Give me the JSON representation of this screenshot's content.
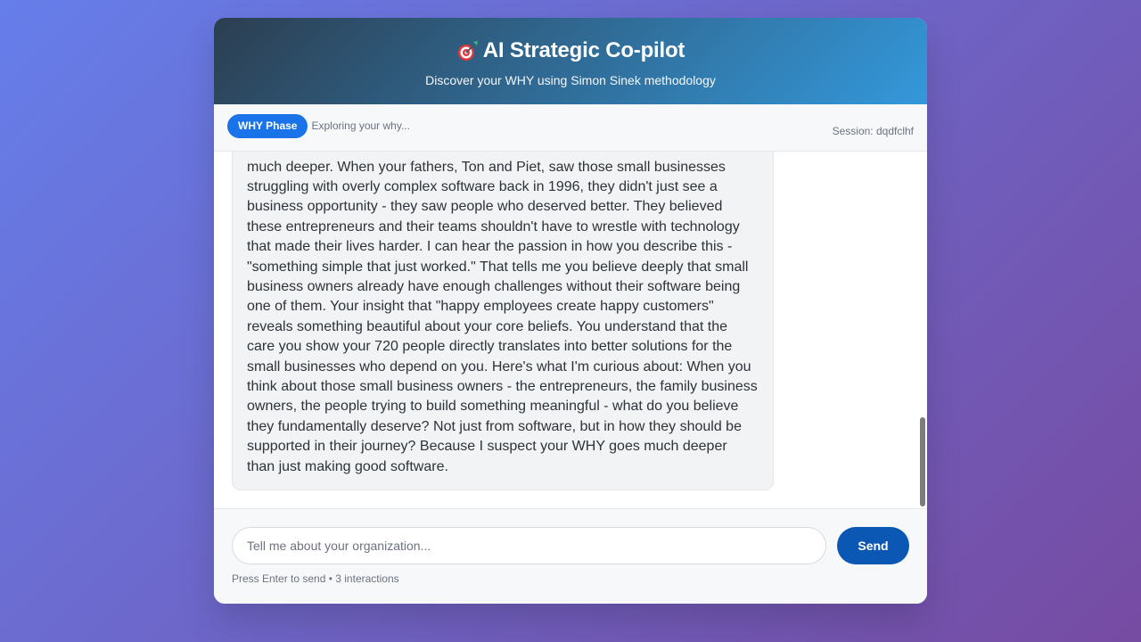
{
  "header": {
    "title": "AI Strategic Co-pilot",
    "subtitle": "Discover your WHY using Simon Sinek methodology",
    "icon": "dart-target-icon"
  },
  "phase": {
    "badge": "WHY Phase",
    "description": "Exploring your why...",
    "session": "Session: dqdfclhf"
  },
  "messages": [
    {
      "role": "assistant",
      "text": "much deeper. When your fathers, Ton and Piet, saw those small businesses struggling with overly complex software back in 1996, they didn't just see a business opportunity - they saw people who deserved better. They believed these entrepreneurs and their teams shouldn't have to wrestle with technology that made their lives harder. I can hear the passion in how you describe this - \"something simple that just worked.\" That tells me you believe deeply that small business owners already have enough challenges without their software being one of them. Your insight that \"happy employees create happy customers\" reveals something beautiful about your core beliefs. You understand that the care you show your 720 people directly translates into better solutions for the small businesses who depend on you. Here's what I'm curious about: When you think about those small business owners - the entrepreneurs, the family business owners, the people trying to build something meaningful - what do you believe they fundamentally deserve? Not just from software, but in how they should be supported in their journey? Because I suspect your WHY goes much deeper than just making good software."
    }
  ],
  "input": {
    "placeholder": "Tell me about your organization...",
    "value": "",
    "send_label": "Send",
    "hint": "Press Enter to send • 3 interactions"
  },
  "colors": {
    "background_start": "#667eea",
    "background_end": "#764ba2",
    "header_start": "#2c3e50",
    "header_end": "#3498db",
    "phase_badge": "#1a73e8",
    "send_button": "#0b57b4"
  }
}
